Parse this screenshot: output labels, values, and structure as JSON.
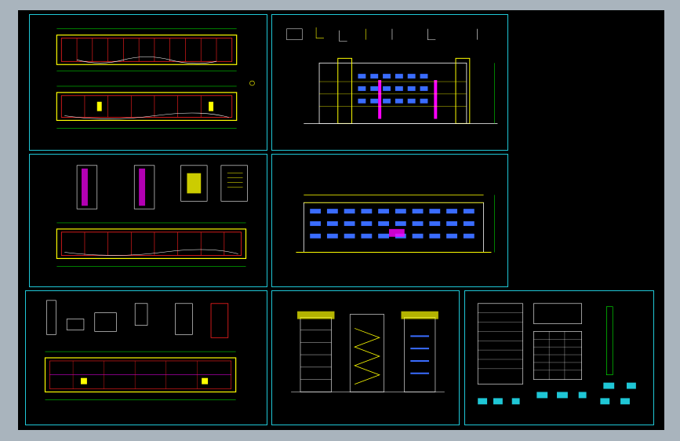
{
  "viewer": {
    "background_color": "#000000",
    "frame_color": "#1fc7d6",
    "chrome_color": "#a9b4bd"
  },
  "sheets": [
    {
      "name": "sheet-floor-plans"
    },
    {
      "name": "sheet-front-elevation"
    },
    {
      "name": "sheet-details-and-plan"
    },
    {
      "name": "sheet-rear-elevation"
    },
    {
      "name": "sheet-roof-plan-details"
    },
    {
      "name": "sheet-sections"
    },
    {
      "name": "sheet-design-notes"
    }
  ],
  "colors": {
    "cyan": "#1fc7d6",
    "yellow": "#ffff00",
    "red": "#ff2020",
    "green": "#00ff00",
    "magenta": "#ff00ff",
    "white": "#ffffff",
    "blue": "#3a6cff"
  }
}
